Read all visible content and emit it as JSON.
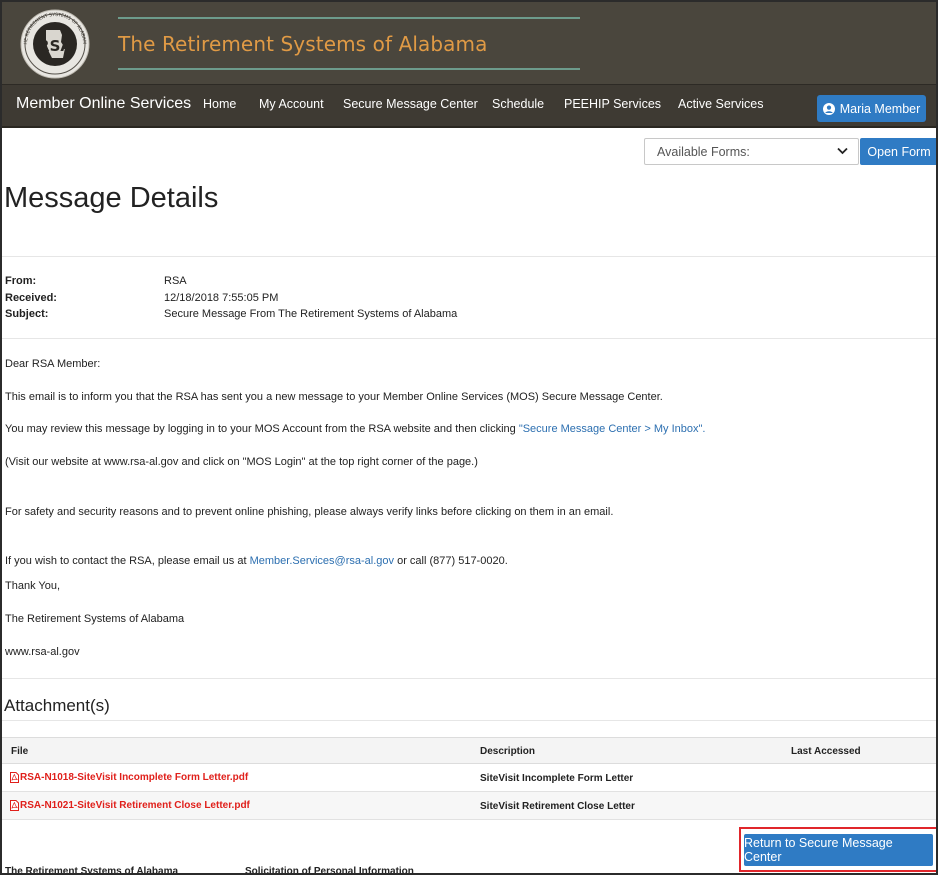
{
  "header": {
    "title": "The Retirement Systems of Alabama",
    "logo_text": "RSA",
    "logo_ring_text": "THE RETIREMENT SYSTEMS OF ALABAMA"
  },
  "nav": {
    "brand": "Member Online Services",
    "items": [
      "Home",
      "My Account",
      "Secure Message Center",
      "Schedule",
      "PEEHIP Services",
      "Active Services"
    ],
    "user_label": "Maria Member"
  },
  "forms": {
    "select_value": "Available Forms:",
    "open_label": "Open Form"
  },
  "page_title": "Message Details",
  "message": {
    "from_label": "From:",
    "from_value": "RSA",
    "received_label": "Received:",
    "received_value": "12/18/2018 7:55:05 PM",
    "subject_label": "Subject:",
    "subject_value": "Secure Message From The Retirement Systems of Alabama"
  },
  "body": {
    "greeting": "Dear RSA Member:",
    "p1": "This email is to inform you that the RSA has sent you a new message to your Member Online Services (MOS) Secure Message Center.",
    "p2_prefix": "You may review this message by logging in to your MOS Account from the RSA website and then clicking ",
    "p2_link": "\"Secure Message Center > My Inbox\".",
    "p3": "(Visit our website at www.rsa-al.gov and click on \"MOS Login\" at the top right corner of the page.)",
    "p4": "For safety and security reasons and to prevent online phishing, please always verify links before clicking on them in an email.",
    "p5_prefix": "If you wish to contact the RSA, please email us at ",
    "p5_link": "Member.Services@rsa-al.gov",
    "p5_suffix": " or call (877) 517-0020.",
    "thanks": "Thank You,",
    "signature": "The Retirement Systems of Alabama",
    "website": "www.rsa-al.gov"
  },
  "attachments": {
    "title": "Attachment(s)",
    "columns": [
      "File",
      "Description",
      "Last Accessed"
    ],
    "rows": [
      {
        "file": "RSA-N1018-SiteVisit Incomplete Form Letter.pdf",
        "description": "SiteVisit Incomplete Form Letter",
        "last_accessed": ""
      },
      {
        "file": "RSA-N1021-SiteVisit Retirement Close Letter.pdf",
        "description": "SiteVisit Retirement Close Letter",
        "last_accessed": ""
      }
    ]
  },
  "return_label": "Return to Secure Message Center",
  "footer": {
    "left": "The Retirement Systems of Alabama",
    "right": "Solicitation of Personal Information"
  },
  "colors": {
    "header_bg": "#4a463d",
    "nav_bg": "#3e3a33",
    "brand_orange": "#e09a45",
    "primary_blue": "#2f7bc4",
    "link_blue": "#2c6fb0",
    "file_red": "#e0201b",
    "highlight_red": "#e0262b"
  }
}
